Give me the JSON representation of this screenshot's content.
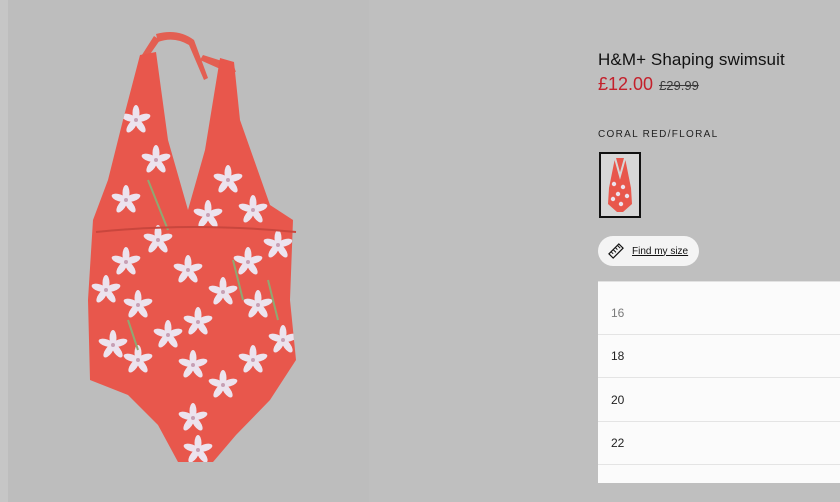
{
  "product": {
    "title": "H&M+ Shaping swimsuit",
    "price_now": "£12.00",
    "price_was": "£29.99",
    "color_name": "CORAL RED/FLORAL"
  },
  "find_size": {
    "label": "Find my size",
    "icon": "ruler-icon"
  },
  "sizes": [
    "16",
    "18",
    "20",
    "22"
  ],
  "colors": {
    "price_now": "#c4202b",
    "swimsuit": "#e8574c",
    "flower": "#e6d9e8",
    "leaf": "#8fa872"
  }
}
